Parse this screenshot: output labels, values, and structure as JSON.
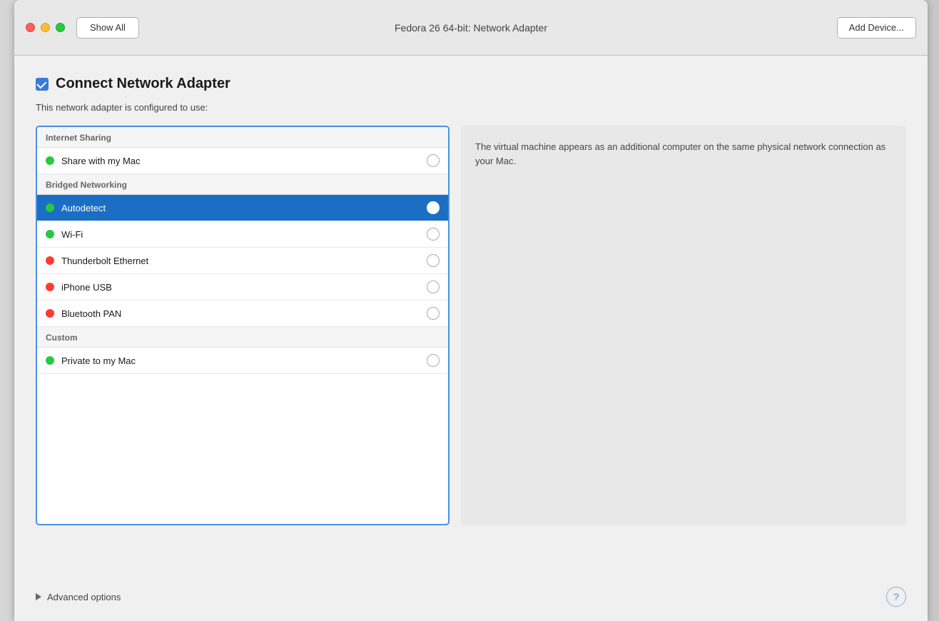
{
  "titlebar": {
    "title": "Fedora 26 64-bit: Network Adapter",
    "show_all_label": "Show All",
    "add_device_label": "Add Device..."
  },
  "header": {
    "connect_title": "Connect Network Adapter",
    "subtitle": "This network adapter is configured to use:"
  },
  "sections": [
    {
      "name": "Internet Sharing",
      "items": [
        {
          "label": "Share with my Mac",
          "dot": "green",
          "selected": false
        }
      ]
    },
    {
      "name": "Bridged Networking",
      "items": [
        {
          "label": "Autodetect",
          "dot": "green",
          "selected": true
        },
        {
          "label": "Wi-Fi",
          "dot": "green",
          "selected": false
        },
        {
          "label": "Thunderbolt Ethernet",
          "dot": "red",
          "selected": false
        },
        {
          "label": "iPhone USB",
          "dot": "red",
          "selected": false
        },
        {
          "label": "Bluetooth PAN",
          "dot": "red",
          "selected": false
        }
      ]
    },
    {
      "name": "Custom",
      "items": [
        {
          "label": "Private to my Mac",
          "dot": "green",
          "selected": false
        }
      ]
    }
  ],
  "description": "The virtual machine appears as an additional computer on the same physical network connection as your Mac.",
  "advanced_options_label": "Advanced options",
  "help_label": "?"
}
